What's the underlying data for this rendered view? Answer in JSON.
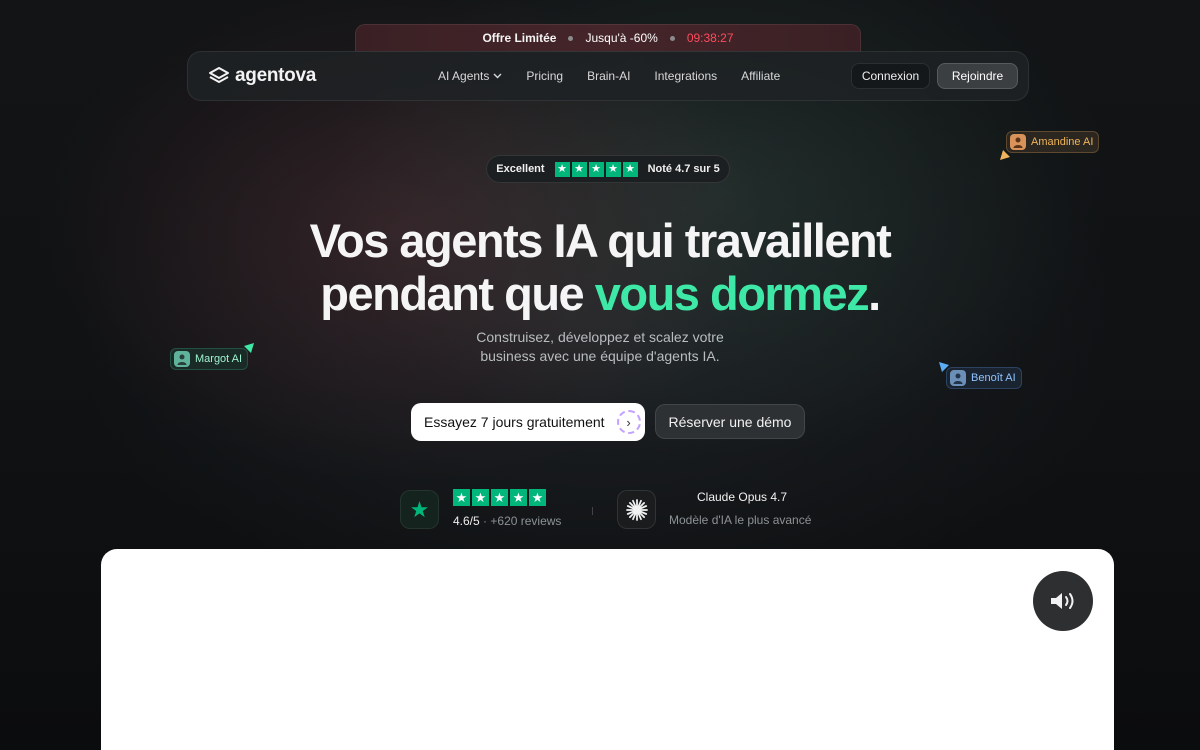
{
  "promo": {
    "label": "Offre Limitée",
    "discount": "Jusqu'à -60%",
    "countdown": "09:38:27",
    "countdown_color": "#ff4b5c"
  },
  "nav": {
    "logo_text": "agentova",
    "items": [
      {
        "label": "AI Agents",
        "has_dropdown": true
      },
      {
        "label": "Pricing"
      },
      {
        "label": "Brain-AI"
      },
      {
        "label": "Integrations"
      },
      {
        "label": "Affiliate"
      }
    ],
    "login_label": "Connexion",
    "join_label": "Rejoindre"
  },
  "rating": {
    "label": "Excellent",
    "score_text": "Noté 4.7 sur 5",
    "stars": 5,
    "star_color": "#00b67a"
  },
  "hero": {
    "title_line1": "Vos agents IA qui travaillent",
    "title_line2_prefix": "pendant que ",
    "title_line2_accent": "vous dormez",
    "title_line2_suffix": ".",
    "accent_color": "#3ee8a6",
    "subtitle_line1": "Construisez, développez et scalez votre",
    "subtitle_line2": "business avec une équipe d'agents IA."
  },
  "agents": [
    {
      "name": "Amandine AI",
      "color": "#f0b45a"
    },
    {
      "name": "Margot AI",
      "color": "#9ff2cf"
    },
    {
      "name": "Benoît AI",
      "color": "#8fc4ff"
    }
  ],
  "cta": {
    "primary_label": "Essayez 7 jours gratuitement",
    "secondary_label": "Réserver une démo"
  },
  "proof": {
    "trustpilot_score": "4.6/5",
    "trustpilot_reviews": "+620 reviews",
    "claude_title": "Claude Opus 4.7",
    "claude_subtitle": "Modèle d'IA le plus avancé"
  },
  "icons": {
    "logo": "agentova-logo-icon",
    "dropdown": "chevron-down-icon",
    "trustpilot": "trustpilot-star-icon",
    "claude": "claude-sparkle-icon",
    "sound": "speaker-icon"
  }
}
